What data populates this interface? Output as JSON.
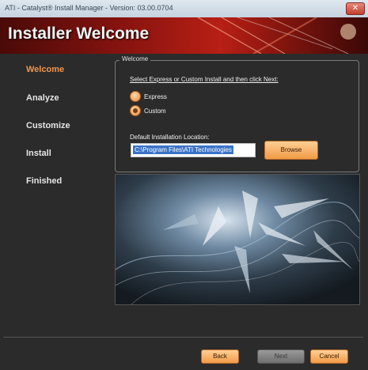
{
  "window": {
    "title": "ATI - Catalyst® Install Manager - Version: 03.00.0704",
    "close_label": "✕"
  },
  "banner": {
    "heading": "Installer Welcome"
  },
  "sidebar": {
    "items": [
      {
        "label": "Welcome",
        "active": true
      },
      {
        "label": "Analyze",
        "active": false
      },
      {
        "label": "Customize",
        "active": false
      },
      {
        "label": "Install",
        "active": false
      },
      {
        "label": "Finished",
        "active": false
      }
    ]
  },
  "welcome_group": {
    "legend": "Welcome",
    "instruction": "Select Express or Custom Install and then click Next:",
    "options": [
      {
        "label": "Express",
        "checked": false
      },
      {
        "label": "Custom",
        "checked": true
      }
    ],
    "location_label": "Default Installation Location:",
    "location_value": "C:\\Program Files\\ATI Technologies",
    "browse_label": "Browse"
  },
  "footer": {
    "back_label": "Back",
    "next_label": "Next",
    "cancel_label": "Cancel"
  },
  "colors": {
    "accent": "#f1954a",
    "banner_red": "#b81f15",
    "background": "#2b2b2b"
  }
}
